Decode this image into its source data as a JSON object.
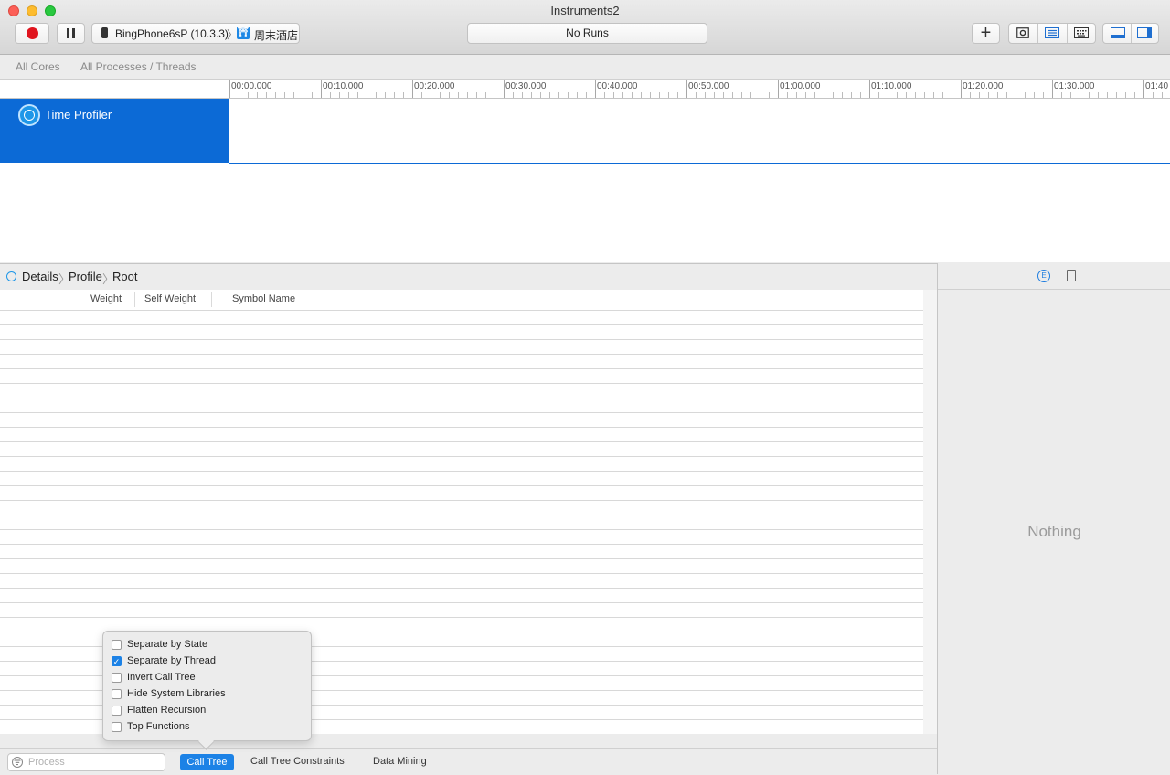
{
  "window": {
    "title": "Instruments2"
  },
  "toolbar": {
    "device": "BingPhone6sP (10.3.3)",
    "crumb_separator": "〉",
    "app": "周末酒店",
    "runs": "No Runs",
    "add_symbol": "+"
  },
  "scope": {
    "cores": "All Cores",
    "processes": "All Processes / Threads"
  },
  "ruler": {
    "ticks": [
      "00:00.000",
      "00:10.000",
      "00:20.000",
      "00:30.000",
      "00:40.000",
      "00:50.000",
      "01:00.000",
      "01:10.000",
      "01:20.000",
      "01:30.000",
      "01:40"
    ]
  },
  "track": {
    "label": "Time Profiler"
  },
  "detail": {
    "crumbs": [
      "Details",
      "Profile",
      "Root"
    ],
    "separator": "〉"
  },
  "table": {
    "columns": [
      "Weight",
      "Self Weight",
      "Symbol Name"
    ]
  },
  "inspector": {
    "empty_label": "Nothing"
  },
  "bottom": {
    "process_placeholder": "Process",
    "tabs": [
      "Call Tree",
      "Call Tree Constraints",
      "Data Mining"
    ]
  },
  "options": [
    {
      "label": "Separate by State",
      "checked": false
    },
    {
      "label": "Separate by Thread",
      "checked": true
    },
    {
      "label": "Invert Call Tree",
      "checked": false
    },
    {
      "label": "Hide System Libraries",
      "checked": false
    },
    {
      "label": "Flatten Recursion",
      "checked": false
    },
    {
      "label": "Top Functions",
      "checked": false
    }
  ],
  "check_mark": "✓",
  "colors": {
    "accent": "#0c6ad6",
    "button_blue": "#1c82e6",
    "record_red": "#e0141e"
  }
}
